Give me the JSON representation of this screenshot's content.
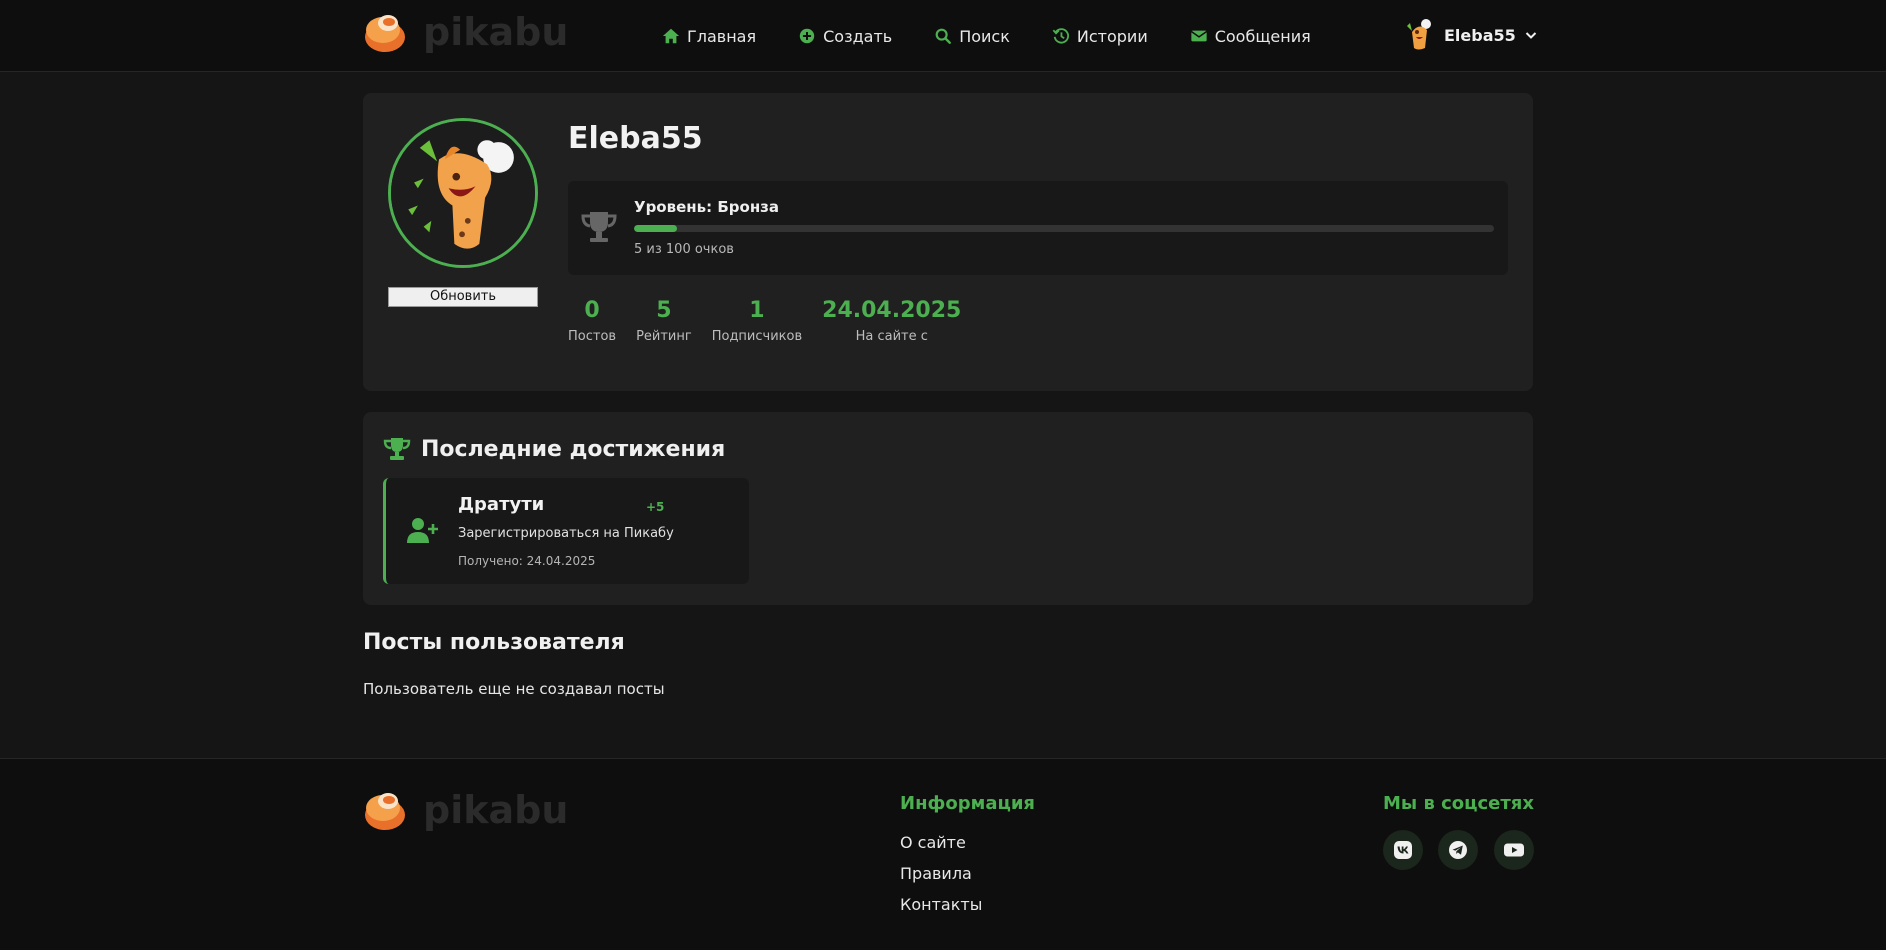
{
  "header": {
    "logo_text": "pikabu",
    "nav": [
      {
        "label": "Главная",
        "icon": "home-icon"
      },
      {
        "label": "Создать",
        "icon": "plus-circle-icon"
      },
      {
        "label": "Поиск",
        "icon": "search-icon"
      },
      {
        "label": "Истории",
        "icon": "history-icon"
      },
      {
        "label": "Сообщения",
        "icon": "envelope-icon"
      }
    ],
    "user": {
      "name": "Eleba55"
    }
  },
  "profile": {
    "username": "Eleba55",
    "refresh_label": "Обновить",
    "level": {
      "title": "Уровень: Бронза",
      "points_text": "5 из 100 очков",
      "progress_fraction": 0.05
    },
    "stats": [
      {
        "value": "0",
        "label": "Постов"
      },
      {
        "value": "5",
        "label": "Рейтинг"
      },
      {
        "value": "1",
        "label": "Подписчиков"
      },
      {
        "value": "24.04.2025",
        "label": "На сайте с"
      }
    ]
  },
  "achievements": {
    "title": "Последние достижения",
    "items": [
      {
        "name": "Дратути",
        "points": "+5",
        "description": "Зарегистрироваться на Пикабу",
        "received": "Получено: 24.04.2025"
      }
    ]
  },
  "posts": {
    "title": "Посты пользователя",
    "empty_text": "Пользователь еще не создавал посты"
  },
  "footer": {
    "logo_text": "pikabu",
    "info_title": "Информация",
    "links": [
      "О сайте",
      "Правила",
      "Контакты"
    ],
    "social_title": "Мы в соцсетях",
    "socials": [
      "vk-icon",
      "telegram-icon",
      "youtube-icon"
    ]
  },
  "colors": {
    "accent": "#4caf50",
    "background": "#151515",
    "card": "#202020",
    "header": "#0e0e0e"
  }
}
